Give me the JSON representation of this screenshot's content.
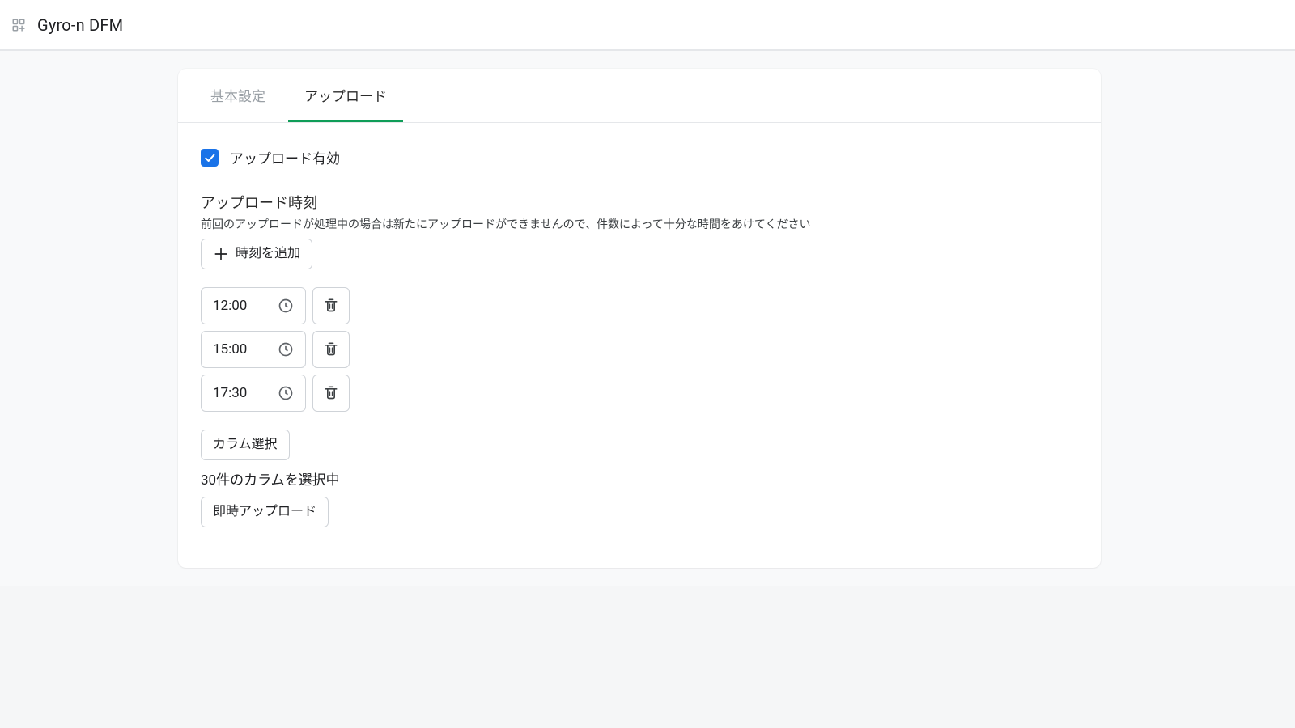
{
  "header": {
    "title": "Gyro-n DFM"
  },
  "tabs": {
    "basic": "基本設定",
    "upload": "アップロード"
  },
  "upload": {
    "enabled_label": "アップロード有効",
    "time_title": "アップロード時刻",
    "time_hint": "前回のアップロードが処理中の場合は新たにアップロードができませんので、件数によって十分な時間をあけてください",
    "add_time_label": "時刻を追加",
    "times": [
      "12:00",
      "15:00",
      "17:30"
    ],
    "column_select_label": "カラム選択",
    "column_info": "30件のカラムを選択中",
    "now_upload_label": "即時アップロード"
  }
}
